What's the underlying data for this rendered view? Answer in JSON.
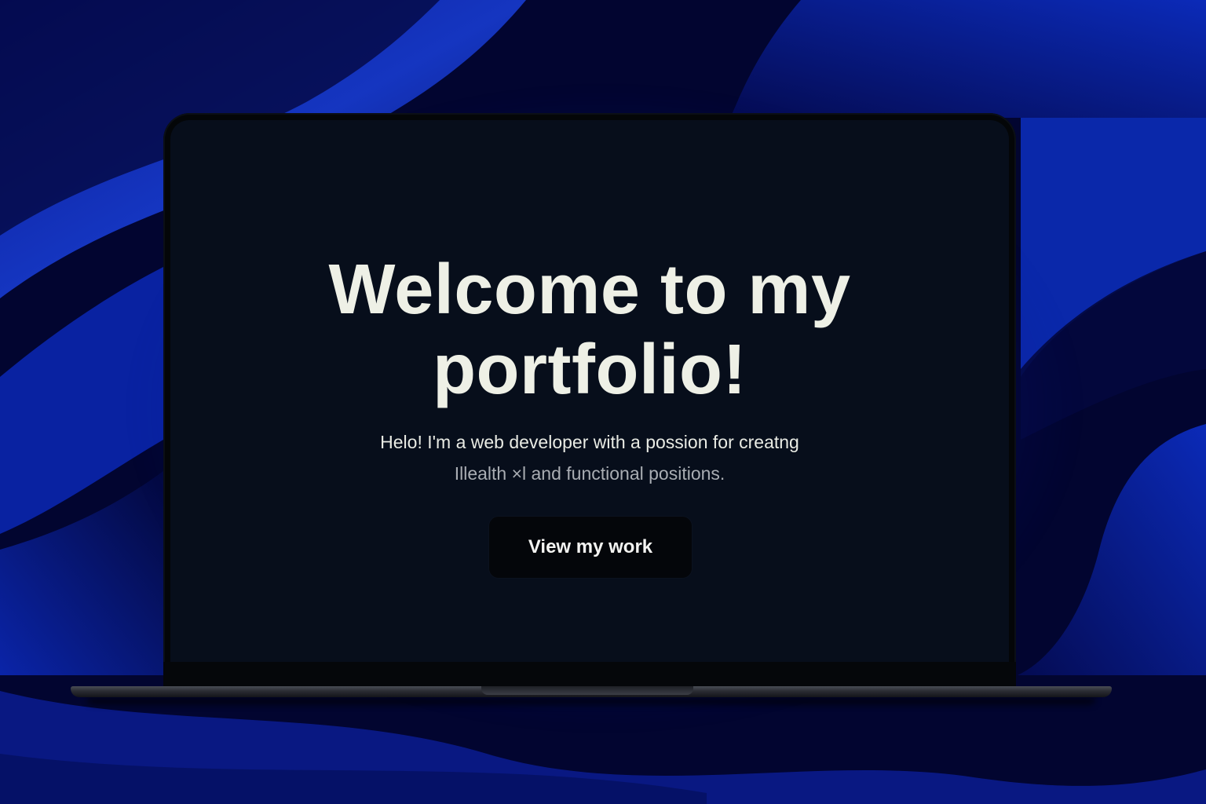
{
  "hero": {
    "title_line1": "Welcome to my",
    "title_line2": "portfolio!",
    "subtitle_line1": "Helo! I'm a web developer with a possion for creatng",
    "subtitle_line2": "Illealth ×l and functional positions.",
    "cta_label": "View my work"
  },
  "colors": {
    "background": "#02042a",
    "accent_blue": "#1230c8",
    "screen": "#070e1b",
    "title_text": "#eef0e6",
    "button_bg": "#04060a"
  }
}
